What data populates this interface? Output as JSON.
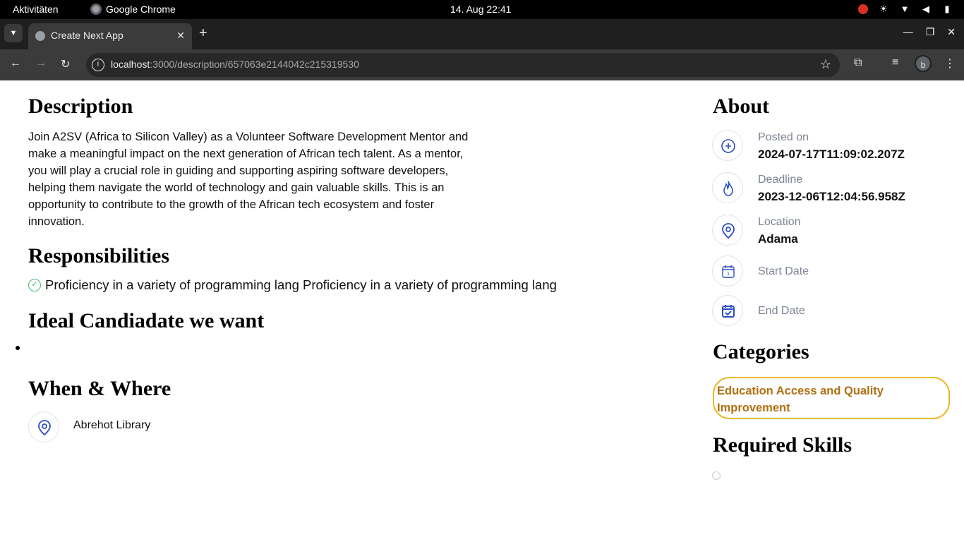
{
  "system_bar": {
    "activities": "Aktivitäten",
    "app_name": "Google Chrome",
    "clock": "14. Aug  22:41"
  },
  "browser": {
    "tab_title": "Create Next App",
    "url_host": "localhost",
    "url_path": ":3000/description/657063e2144042c215319530",
    "profile_initial": "b"
  },
  "main": {
    "description_heading": "Description",
    "description_text": "Join A2SV (Africa to Silicon Valley) as a Volunteer Software Development Mentor and make a meaningful impact on the next generation of African tech talent. As a mentor, you will play a crucial role in guiding and supporting aspiring software developers, helping them navigate the world of technology and gain valuable skills. This is an opportunity to contribute to the growth of the African tech ecosystem and foster innovation.",
    "responsibilities_heading": "Responsibilities",
    "responsibilities": [
      "Proficiency in a variety of programming lang Proficiency in a variety of programming lang"
    ],
    "ideal_heading": "Ideal Candiadate we want",
    "when_where_heading": "When & Where",
    "location": "Abrehot Library"
  },
  "sidebar": {
    "about_heading": "About",
    "about_items": [
      {
        "label": "Posted on",
        "value": "2024-07-17T11:09:02.207Z",
        "icon": "plus-circle-icon"
      },
      {
        "label": "Deadline",
        "value": "2023-12-06T12:04:56.958Z",
        "icon": "fire-icon"
      },
      {
        "label": "Location",
        "value": "Adama",
        "icon": "location-pin-icon"
      },
      {
        "label": "Start Date",
        "value": "",
        "icon": "calendar-icon"
      },
      {
        "label": "End Date",
        "value": "",
        "icon": "calendar-check-icon"
      }
    ],
    "categories_heading": "Categories",
    "categories": [
      "Education Access and Quality Improvement"
    ],
    "skills_heading": "Required Skills"
  },
  "colors": {
    "accent_blue": "#2b4fbf",
    "category_border": "#e8b928",
    "category_text": "#b06f10",
    "check_green": "#3fbf6a"
  }
}
